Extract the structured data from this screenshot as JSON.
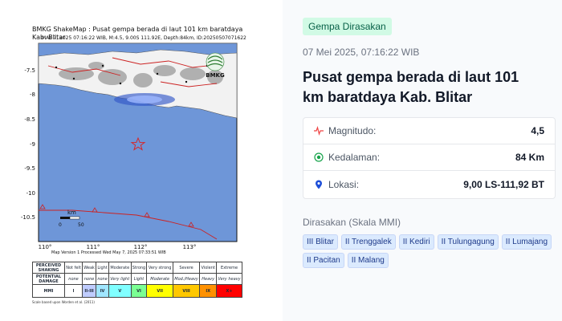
{
  "map": {
    "title": "BMKG ShakeMap : Pusat gempa berada di laut 101 km baratdaya Kab. Blitar",
    "subtitle": "MAY 7, 2025 07:16:22 WIB, M:4.5, 9.00S 111.92E, Depth:84km, ID:20250507071622",
    "logo_text": "BMKG",
    "lat_labels": [
      "-7.5",
      "-8",
      "-8.5",
      "-9",
      "-9.5",
      "-10",
      "-10.5"
    ],
    "lon_labels": [
      "110°",
      "111°",
      "112°",
      "113°"
    ],
    "scale_label": "km",
    "scale_ticks": [
      "0",
      "50"
    ],
    "footer": "Map Version 1 Processed Wed May 7, 2025 07:33:51 WIB",
    "scale_note": "Scale based upon Worden et al. (2011)",
    "colors": {
      "sea": "#6e96d8",
      "land": "#ffffff",
      "epicenter": "#d62728"
    }
  },
  "mmi_table": {
    "row_headers": [
      "PERCEIVED SHAKING",
      "POTENTIAL DAMAGE",
      "MMI"
    ],
    "shaking": [
      "Not felt",
      "Weak",
      "Light",
      "Moderate",
      "Strong",
      "Very strong",
      "Severe",
      "Violent",
      "Extreme"
    ],
    "damage": [
      "none",
      "none",
      "none",
      "Very light",
      "Light",
      "Moderate",
      "Mod./Heavy",
      "Heavy",
      "Very heavy"
    ],
    "mmi": [
      "I",
      "II-III",
      "IV",
      "V",
      "VI",
      "VII",
      "VIII",
      "IX",
      "X+"
    ],
    "mmi_colors": [
      "#ffffff",
      "#bfccff",
      "#a0e6ff",
      "#80ffff",
      "#7aff93",
      "#ffff00",
      "#ffc800",
      "#ff9100",
      "#ff0000"
    ]
  },
  "info": {
    "badge": "Gempa Dirasakan",
    "timestamp": "07 Mei 2025, 07:16:22 WIB",
    "headline": "Pusat gempa berada di laut 101 km baratdaya Kab. Blitar",
    "stats": {
      "magnitude": {
        "label": "Magnitudo:",
        "value": "4,5",
        "icon": "pulse-icon"
      },
      "depth": {
        "label": "Kedalaman:",
        "value": "84 Km",
        "icon": "target-icon"
      },
      "location": {
        "label": "Lokasi:",
        "value": "9,00 LS-111,92 BT",
        "icon": "map-pin-icon"
      }
    },
    "felt_title": "Dirasakan (Skala MMI)",
    "felt_tags": [
      "III Blitar",
      "II Trenggalek",
      "II Kediri",
      "II Tulungagung",
      "II Lumajang",
      "II Pacitan",
      "II Malang"
    ],
    "colors": {
      "badge_bg": "#d1fae5",
      "tag_bg": "#dbeafe",
      "magnitude_icon": "#ef4444",
      "depth_icon": "#16a34a",
      "location_icon": "#1d4ed8"
    }
  }
}
